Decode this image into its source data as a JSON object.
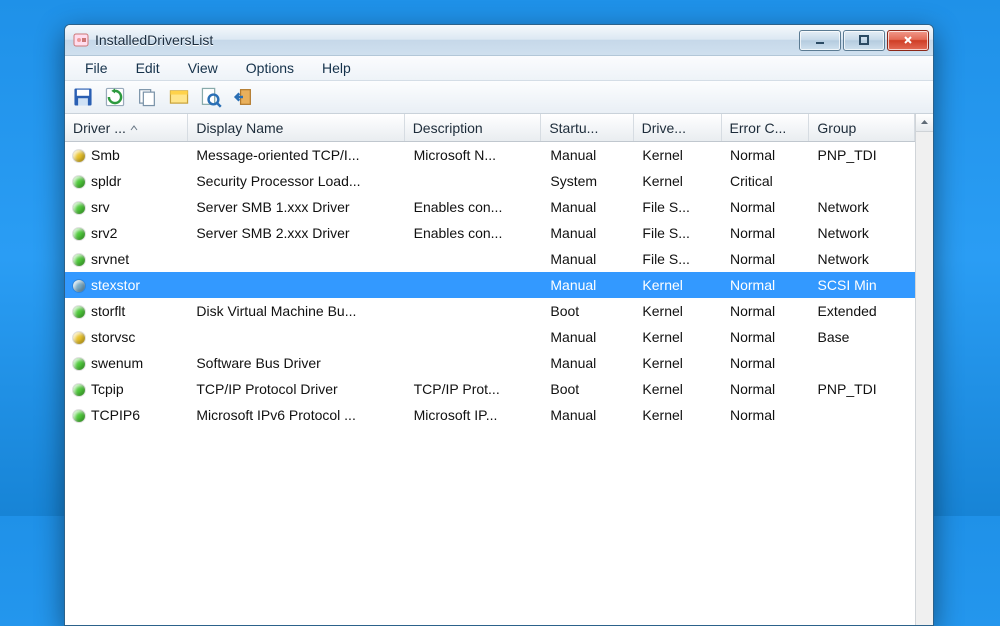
{
  "window": {
    "title": "InstalledDriversList"
  },
  "menu": {
    "file": "File",
    "edit": "Edit",
    "view": "View",
    "options": "Options",
    "help": "Help"
  },
  "columns": {
    "driver": "Driver ...",
    "display": "Display Name",
    "desc": "Description",
    "startup": "Startu...",
    "drive": "Drive...",
    "error": "Error C...",
    "group": "Group"
  },
  "rows": [
    {
      "dot": "#e8c22a",
      "driver": "Smb",
      "display": "Message-oriented TCP/I...",
      "desc": "Microsoft N...",
      "startup": "Manual",
      "drive": "Kernel",
      "error": "Normal",
      "group": "PNP_TDI",
      "selected": false
    },
    {
      "dot": "#4ec93a",
      "driver": "spldr",
      "display": "Security Processor Load...",
      "desc": "",
      "startup": "System",
      "drive": "Kernel",
      "error": "Critical",
      "group": "",
      "selected": false
    },
    {
      "dot": "#4ec93a",
      "driver": "srv",
      "display": "Server SMB 1.xxx Driver",
      "desc": "Enables con...",
      "startup": "Manual",
      "drive": "File S...",
      "error": "Normal",
      "group": "Network",
      "selected": false
    },
    {
      "dot": "#4ec93a",
      "driver": "srv2",
      "display": "Server SMB 2.xxx Driver",
      "desc": "Enables con...",
      "startup": "Manual",
      "drive": "File S...",
      "error": "Normal",
      "group": "Network",
      "selected": false
    },
    {
      "dot": "#4ec93a",
      "driver": "srvnet",
      "display": "",
      "desc": "",
      "startup": "Manual",
      "drive": "File S...",
      "error": "Normal",
      "group": "Network",
      "selected": false
    },
    {
      "dot": "#7aaac4",
      "driver": "stexstor",
      "display": "",
      "desc": "",
      "startup": "Manual",
      "drive": "Kernel",
      "error": "Normal",
      "group": "SCSI Min",
      "selected": true
    },
    {
      "dot": "#4ec93a",
      "driver": "storflt",
      "display": "Disk Virtual Machine Bu...",
      "desc": "",
      "startup": "Boot",
      "drive": "Kernel",
      "error": "Normal",
      "group": "Extended",
      "selected": false
    },
    {
      "dot": "#e8c22a",
      "driver": "storvsc",
      "display": "",
      "desc": "",
      "startup": "Manual",
      "drive": "Kernel",
      "error": "Normal",
      "group": "Base",
      "selected": false
    },
    {
      "dot": "#4ec93a",
      "driver": "swenum",
      "display": "Software Bus Driver",
      "desc": "",
      "startup": "Manual",
      "drive": "Kernel",
      "error": "Normal",
      "group": "",
      "selected": false
    },
    {
      "dot": "#4ec93a",
      "driver": "Tcpip",
      "display": "TCP/IP Protocol Driver",
      "desc": "TCP/IP Prot...",
      "startup": "Boot",
      "drive": "Kernel",
      "error": "Normal",
      "group": "PNP_TDI",
      "selected": false
    },
    {
      "dot": "#4ec93a",
      "driver": "TCPIP6",
      "display": "Microsoft IPv6 Protocol ...",
      "desc": "Microsoft IP...",
      "startup": "Manual",
      "drive": "Kernel",
      "error": "Normal",
      "group": "",
      "selected": false
    }
  ]
}
